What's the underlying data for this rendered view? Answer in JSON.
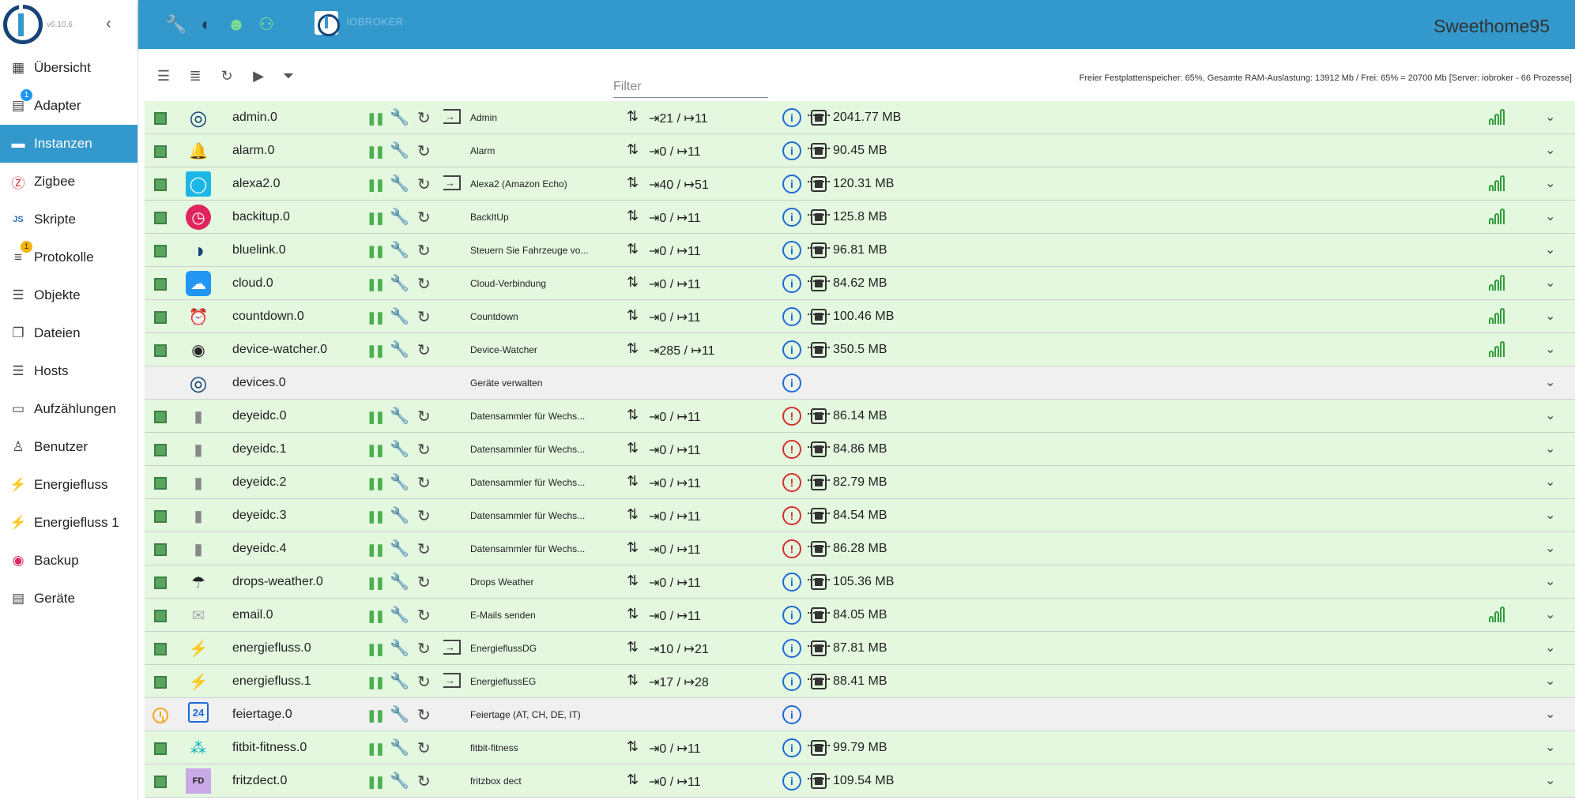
{
  "app": {
    "version": "v6.10.6",
    "brand": "IOBROKER",
    "hostname": "Sweethome95"
  },
  "sidebar": {
    "items": [
      {
        "label": "Übersicht",
        "icon": "grid-icon",
        "glyph": "▦",
        "active": false,
        "badge": "",
        "badge_color": ""
      },
      {
        "label": "Adapter",
        "icon": "store-icon",
        "glyph": "▤",
        "active": false,
        "badge": "1",
        "badge_color": "#2196f3"
      },
      {
        "label": "Instanzen",
        "icon": "instances-icon",
        "glyph": "▬",
        "active": true,
        "badge": "",
        "badge_color": ""
      },
      {
        "label": "Zigbee",
        "icon": "zigbee-icon",
        "glyph": "Ⓩ",
        "active": false,
        "badge": "",
        "badge_color": ""
      },
      {
        "label": "Skripte",
        "icon": "scripts-icon",
        "glyph": "JS",
        "active": false,
        "badge": "",
        "badge_color": ""
      },
      {
        "label": "Protokolle",
        "icon": "log-icon",
        "glyph": "≡",
        "active": false,
        "badge": "1",
        "badge_color": "#f5b400"
      },
      {
        "label": "Objekte",
        "icon": "objects-icon",
        "glyph": "☰",
        "active": false,
        "badge": "",
        "badge_color": ""
      },
      {
        "label": "Dateien",
        "icon": "files-icon",
        "glyph": "❐",
        "active": false,
        "badge": "",
        "badge_color": ""
      },
      {
        "label": "Hosts",
        "icon": "hosts-icon",
        "glyph": "☰",
        "active": false,
        "badge": "",
        "badge_color": ""
      },
      {
        "label": "Aufzählungen",
        "icon": "enums-icon",
        "glyph": "▭",
        "active": false,
        "badge": "",
        "badge_color": ""
      },
      {
        "label": "Benutzer",
        "icon": "user-icon",
        "glyph": "♙",
        "active": false,
        "badge": "",
        "badge_color": ""
      },
      {
        "label": "Energiefluss",
        "icon": "energy-flow-icon",
        "glyph": "⚡",
        "active": false,
        "badge": "",
        "badge_color": ""
      },
      {
        "label": "Energiefluss 1",
        "icon": "energy-flow-icon",
        "glyph": "⚡",
        "active": false,
        "badge": "",
        "badge_color": ""
      },
      {
        "label": "Backup",
        "icon": "backup-icon",
        "glyph": "◉",
        "active": false,
        "badge": "",
        "badge_color": ""
      },
      {
        "label": "Geräte",
        "icon": "devices-icon",
        "glyph": "▤",
        "active": false,
        "badge": "",
        "badge_color": ""
      }
    ]
  },
  "toolbar": {
    "filter_placeholder": "Filter",
    "status": "Freier Festplattenspeicher: 65%, Gesamte RAM-Auslastung: 13912 Mb / Frei: 65% = 20700 Mb [Server: iobroker - 66 Prozesse]"
  },
  "colors": {
    "accent": "#3399cc",
    "row_enabled": "#e3f8df",
    "row_disabled": "#f0f0f0",
    "running": "#4caf50",
    "info": "#1e6ad6",
    "error": "#d32f2f"
  },
  "instances": [
    {
      "name": "admin.0",
      "title": "Admin",
      "icon": "iobroker-logo-icon",
      "glyph": "◎",
      "io": "⇥21 / ↦11",
      "mem": "2041.77 MB",
      "enabled": true,
      "login": true,
      "status": "ok",
      "signal": true
    },
    {
      "name": "alarm.0",
      "title": "Alarm",
      "icon": "alarm-icon",
      "glyph": "🔔",
      "io": "⇥0 / ↦11",
      "mem": "90.45 MB",
      "enabled": true,
      "login": false,
      "status": "ok",
      "signal": false
    },
    {
      "name": "alexa2.0",
      "title": "Alexa2 (Amazon Echo)",
      "icon": "alexa-icon",
      "glyph": "◯",
      "io": "⇥40 / ↦51",
      "mem": "120.31 MB",
      "enabled": true,
      "login": true,
      "status": "ok",
      "signal": true
    },
    {
      "name": "backitup.0",
      "title": "BackItUp",
      "icon": "backitup-icon",
      "glyph": "◷",
      "io": "⇥0 / ↦11",
      "mem": "125.8 MB",
      "enabled": true,
      "login": false,
      "status": "ok",
      "signal": true
    },
    {
      "name": "bluelink.0",
      "title": "Steuern Sie Fahrzeuge vo...",
      "icon": "bluelink-icon",
      "glyph": "◑",
      "io": "⇥0 / ↦11",
      "mem": "96.81 MB",
      "enabled": true,
      "login": false,
      "status": "ok",
      "signal": false
    },
    {
      "name": "cloud.0",
      "title": "Cloud-Verbindung",
      "icon": "cloud-icon",
      "glyph": "☁",
      "io": "⇥0 / ↦11",
      "mem": "84.62 MB",
      "enabled": true,
      "login": false,
      "status": "ok",
      "signal": true
    },
    {
      "name": "countdown.0",
      "title": "Countdown",
      "icon": "alarm-clock-icon",
      "glyph": "⏰",
      "io": "⇥0 / ↦11",
      "mem": "100.46 MB",
      "enabled": true,
      "login": false,
      "status": "ok",
      "signal": true
    },
    {
      "name": "device-watcher.0",
      "title": "Device-Watcher",
      "icon": "eye-icon",
      "glyph": "◉",
      "io": "⇥285 / ↦11",
      "mem": "350.5 MB",
      "enabled": true,
      "login": false,
      "status": "ok",
      "signal": true
    },
    {
      "name": "devices.0",
      "title": "Geräte verwalten",
      "icon": "iobroker-logo-icon",
      "glyph": "◎",
      "io": "",
      "mem": "",
      "enabled": null,
      "login": false,
      "status": "ok",
      "signal": false
    },
    {
      "name": "deyeidc.0",
      "title": "Datensammler für Wechs...",
      "icon": "inverter-icon",
      "glyph": "▮",
      "io": "⇥0 / ↦11",
      "mem": "86.14 MB",
      "enabled": true,
      "login": false,
      "status": "err",
      "signal": false
    },
    {
      "name": "deyeidc.1",
      "title": "Datensammler für Wechs...",
      "icon": "inverter-icon",
      "glyph": "▮",
      "io": "⇥0 / ↦11",
      "mem": "84.86 MB",
      "enabled": true,
      "login": false,
      "status": "err",
      "signal": false
    },
    {
      "name": "deyeidc.2",
      "title": "Datensammler für Wechs...",
      "icon": "inverter-icon",
      "glyph": "▮",
      "io": "⇥0 / ↦11",
      "mem": "82.79 MB",
      "enabled": true,
      "login": false,
      "status": "err",
      "signal": false
    },
    {
      "name": "deyeidc.3",
      "title": "Datensammler für Wechs...",
      "icon": "inverter-icon",
      "glyph": "▮",
      "io": "⇥0 / ↦11",
      "mem": "84.54 MB",
      "enabled": true,
      "login": false,
      "status": "err",
      "signal": false
    },
    {
      "name": "deyeidc.4",
      "title": "Datensammler für Wechs...",
      "icon": "inverter-icon",
      "glyph": "▮",
      "io": "⇥0 / ↦11",
      "mem": "86.28 MB",
      "enabled": true,
      "login": false,
      "status": "err",
      "signal": false
    },
    {
      "name": "drops-weather.0",
      "title": "Drops Weather",
      "icon": "rain-cloud-icon",
      "glyph": "☂",
      "io": "⇥0 / ↦11",
      "mem": "105.36 MB",
      "enabled": true,
      "login": false,
      "status": "ok",
      "signal": false
    },
    {
      "name": "email.0",
      "title": "E-Mails senden",
      "icon": "envelope-icon",
      "glyph": "✉",
      "io": "⇥0 / ↦11",
      "mem": "84.05 MB",
      "enabled": true,
      "login": false,
      "status": "ok",
      "signal": true
    },
    {
      "name": "energiefluss.0",
      "title": "EnergieflussDG",
      "icon": "energy-flow-icon",
      "glyph": "⚡",
      "io": "⇥10 / ↦21",
      "mem": "87.81 MB",
      "enabled": true,
      "login": true,
      "status": "ok",
      "signal": false
    },
    {
      "name": "energiefluss.1",
      "title": "EnergieflussEG",
      "icon": "energy-flow-icon",
      "glyph": "⚡",
      "io": "⇥17 / ↦28",
      "mem": "88.41 MB",
      "enabled": true,
      "login": true,
      "status": "ok",
      "signal": false
    },
    {
      "name": "feiertage.0",
      "title": "Feiertage (AT, CH, DE, IT)",
      "icon": "calendar-icon",
      "glyph": "24",
      "io": "",
      "mem": "",
      "enabled": "schedule",
      "login": false,
      "status": "ok",
      "signal": false
    },
    {
      "name": "fitbit-fitness.0",
      "title": "fitbit-fitness",
      "icon": "fitbit-icon",
      "glyph": "⁂",
      "io": "⇥0 / ↦11",
      "mem": "99.79 MB",
      "enabled": true,
      "login": false,
      "status": "ok",
      "signal": false
    },
    {
      "name": "fritzdect.0",
      "title": "fritzbox dect",
      "icon": "fritz-dect-icon",
      "glyph": "FD",
      "io": "⇥0 / ↦11",
      "mem": "109.54 MB",
      "enabled": true,
      "login": false,
      "status": "ok",
      "signal": false
    }
  ]
}
